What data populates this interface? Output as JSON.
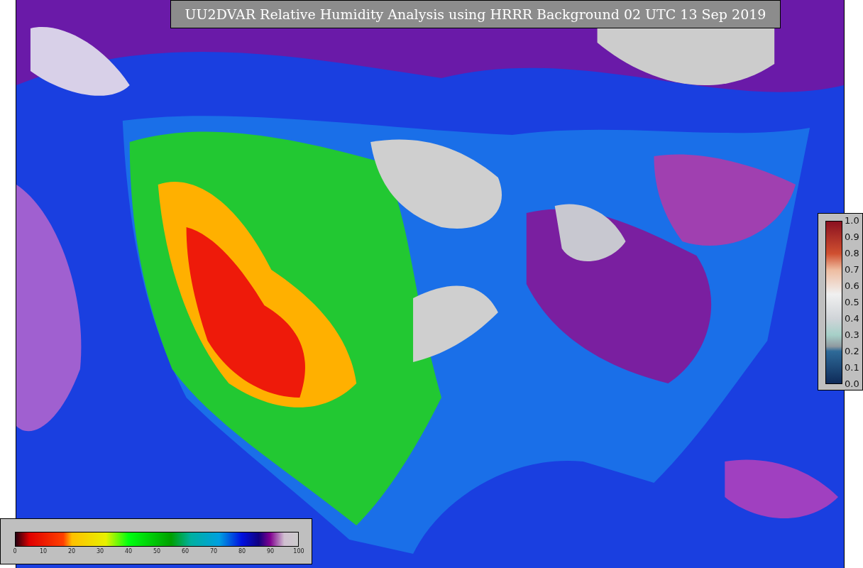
{
  "title": "UU2DVAR Relative Humidity Analysis using HRRR Background 02 UTC 13 Sep 2019",
  "humidity_colorbar": {
    "ticks": [
      "0",
      "10",
      "20",
      "30",
      "40",
      "50",
      "60",
      "70",
      "80",
      "90",
      "100"
    ]
  },
  "ratio_colorbar": {
    "ticks": [
      "1.0",
      "0.9",
      "0.8",
      "0.7",
      "0.6",
      "0.5",
      "0.4",
      "0.3",
      "0.2",
      "0.1",
      "0.0"
    ]
  }
}
